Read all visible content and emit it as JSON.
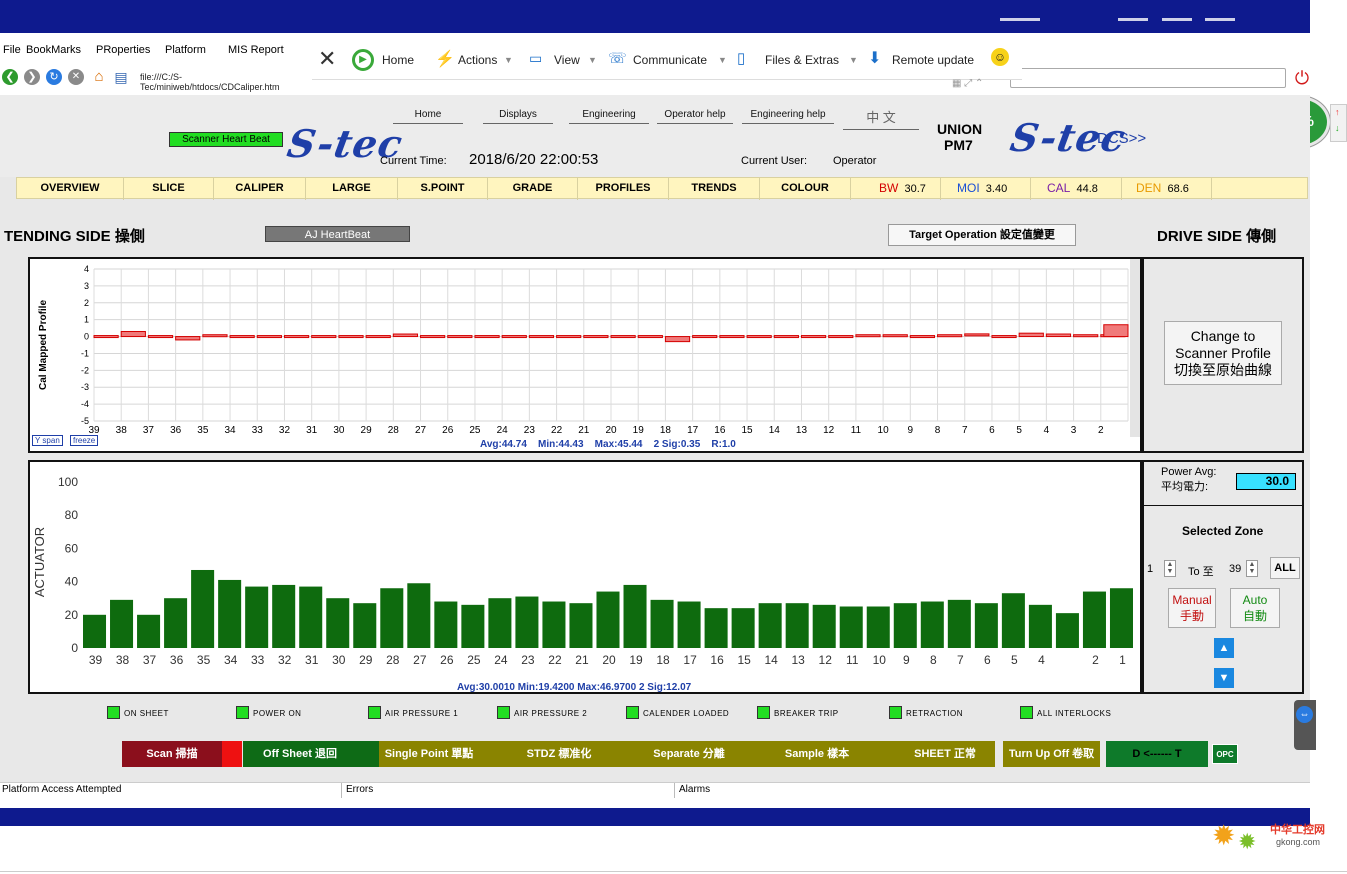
{
  "browser": {
    "menu": [
      "File",
      "BookMarks",
      "PRoperties",
      "Platform",
      "MIS Report"
    ],
    "toolbar": {
      "home": "Home",
      "actions": "Actions",
      "view": "View",
      "communicate": "Communicate",
      "files_extras": "Files & Extras",
      "remote_update": "Remote update"
    },
    "address": "file:///C:/S-Tec/miniweb/htdocs/CDCaliper.htm",
    "percent_badge": "48%"
  },
  "header": {
    "heartbeat": "Scanner Heart Beat",
    "logo": "S-tec",
    "nav": [
      "Home",
      "Displays",
      "Engineering",
      "Operator help",
      "Engineering help",
      "中 文"
    ],
    "current_time_label": "Current Time:",
    "current_time": "2018/6/20 22:00:53",
    "current_user_label": "Current User:",
    "current_user": "Operator",
    "union": "UNION",
    "pm": "PM7",
    "dcs": "DCS>>"
  },
  "tabs": [
    "OVERVIEW",
    "SLICE",
    "CALIPER",
    "LARGE",
    "S.POINT",
    "GRADE",
    "PROFILES",
    "TRENDS",
    "COLOUR"
  ],
  "stats": [
    {
      "label": "BW",
      "value": "30.7",
      "color": "#d40000"
    },
    {
      "label": "MOI",
      "value": "3.40",
      "color": "#1a4fd6"
    },
    {
      "label": "CAL",
      "value": "44.8",
      "color": "#7a1fa8"
    },
    {
      "label": "DEN",
      "value": "68.6",
      "color": "#e89a00"
    }
  ],
  "section": {
    "tending": "TENDING SIDE 操側",
    "aj_heartbeat": "AJ HeartBeat",
    "target_op": "Target Operation 設定值變更",
    "drive": "DRIVE SIDE 傳側"
  },
  "profile_panel": {
    "change_btn": [
      "Change to",
      "Scanner Profile",
      "切換至原始曲線"
    ],
    "yspan": "Y span",
    "freeze": "freeze",
    "ylabel": "Cal Mapped Profile",
    "stats": "Avg:44.74    Min:44.43    Max:45.44    2 Sig:0.35    R:1.0"
  },
  "actuator_panel": {
    "power_avg_label": "Power Avg:",
    "power_avg_cn": "平均電力:",
    "power_avg": "30.0",
    "selected_zone": "Selected Zone",
    "zone_from": "1",
    "zone_to_label": "To 至",
    "zone_to": "39",
    "all": "ALL",
    "manual": "Manual",
    "manual_cn": "手動",
    "auto": "Auto",
    "auto_cn": "自動",
    "stats": "Avg:30.0010 Min:19.4200 Max:46.9700  2 Sig:12.07"
  },
  "indicators": [
    "ON SHEET",
    "POWER ON",
    "AIR PRESSURE 1",
    "AIR PRESSURE 2",
    "CALENDER LOADED",
    "BREAKER TRIP",
    "RETRACTION",
    "ALL INTERLOCKS"
  ],
  "commands": [
    {
      "label": "Scan 掃描",
      "bg": "#8b0f1c",
      "fg": "#ffffff"
    },
    {
      "label": "Off Sheet 退回",
      "bg": "#0e6b16",
      "fg": "#ffffff"
    },
    {
      "label": "Single Point 單點",
      "bg": "#8a8400",
      "fg": "#ffffff"
    },
    {
      "label": "STDZ 標准化",
      "bg": "#8a8400",
      "fg": "#ffffff"
    },
    {
      "label": "Separate 分離",
      "bg": "#8a8400",
      "fg": "#ffffff"
    },
    {
      "label": "Sample 樣本",
      "bg": "#8a8400",
      "fg": "#ffffff"
    },
    {
      "label": "SHEET 正常",
      "bg": "#8a8400",
      "fg": "#ffffff"
    },
    {
      "label": "Turn Up Off 卷取",
      "bg": "#8a8400",
      "fg": "#ffffff"
    },
    {
      "label": "D <------ T",
      "bg": "#0e7a2a",
      "fg": "#000000"
    },
    {
      "label": "OPC",
      "bg": "#0e7a2a",
      "fg": "#ffffff"
    }
  ],
  "status": {
    "platform": "Platform Access Attempted",
    "errors": "Errors",
    "alarms": "Alarms"
  },
  "watermark": {
    "cn": "中华工控网",
    "url": "gkong.com"
  },
  "chart_data": [
    {
      "type": "bar",
      "ylabel": "Cal Mapped Profile",
      "ylim": [
        -5,
        4
      ],
      "categories": [
        "39",
        "38",
        "37",
        "36",
        "35",
        "34",
        "33",
        "32",
        "31",
        "30",
        "29",
        "28",
        "27",
        "26",
        "25",
        "24",
        "23",
        "22",
        "21",
        "20",
        "19",
        "18",
        "17",
        "16",
        "15",
        "14",
        "13",
        "12",
        "11",
        "10",
        "9",
        "8",
        "7",
        "6",
        "5",
        "4",
        "3",
        "2"
      ],
      "values": [
        0.0,
        0.3,
        0.0,
        -0.2,
        0.05,
        -0.05,
        -0.1,
        -0.05,
        0.0,
        -0.1,
        0.0,
        0.15,
        -0.05,
        -0.05,
        0.0,
        0.0,
        -0.05,
        -0.1,
        -0.05,
        0.0,
        0.0,
        -0.3,
        -0.05,
        -0.05,
        0.0,
        0.0,
        0.0,
        -0.05,
        0.05,
        0.05,
        0.0,
        0.05,
        0.1,
        -0.05,
        0.2,
        0.15,
        0.05,
        0.05,
        0.7
      ]
    },
    {
      "type": "bar",
      "ylabel": "ACTUATOR",
      "ylim": [
        0,
        100
      ],
      "categories": [
        "39",
        "38",
        "37",
        "36",
        "35",
        "34",
        "33",
        "32",
        "31",
        "30",
        "29",
        "28",
        "27",
        "26",
        "25",
        "24",
        "23",
        "22",
        "21",
        "20",
        "19",
        "18",
        "17",
        "16",
        "15",
        "14",
        "13",
        "12",
        "11",
        "10",
        "9",
        "8",
        "7",
        "6",
        "5",
        "4",
        "",
        "2",
        "1"
      ],
      "values": [
        20,
        29,
        20,
        30,
        47,
        41,
        37,
        38,
        37,
        30,
        27,
        36,
        39,
        28,
        26,
        30,
        31,
        28,
        27,
        34,
        38,
        29,
        28,
        24,
        24,
        27,
        27,
        26,
        25,
        25,
        27,
        28,
        29,
        27,
        33,
        26,
        21,
        34,
        36
      ]
    }
  ]
}
